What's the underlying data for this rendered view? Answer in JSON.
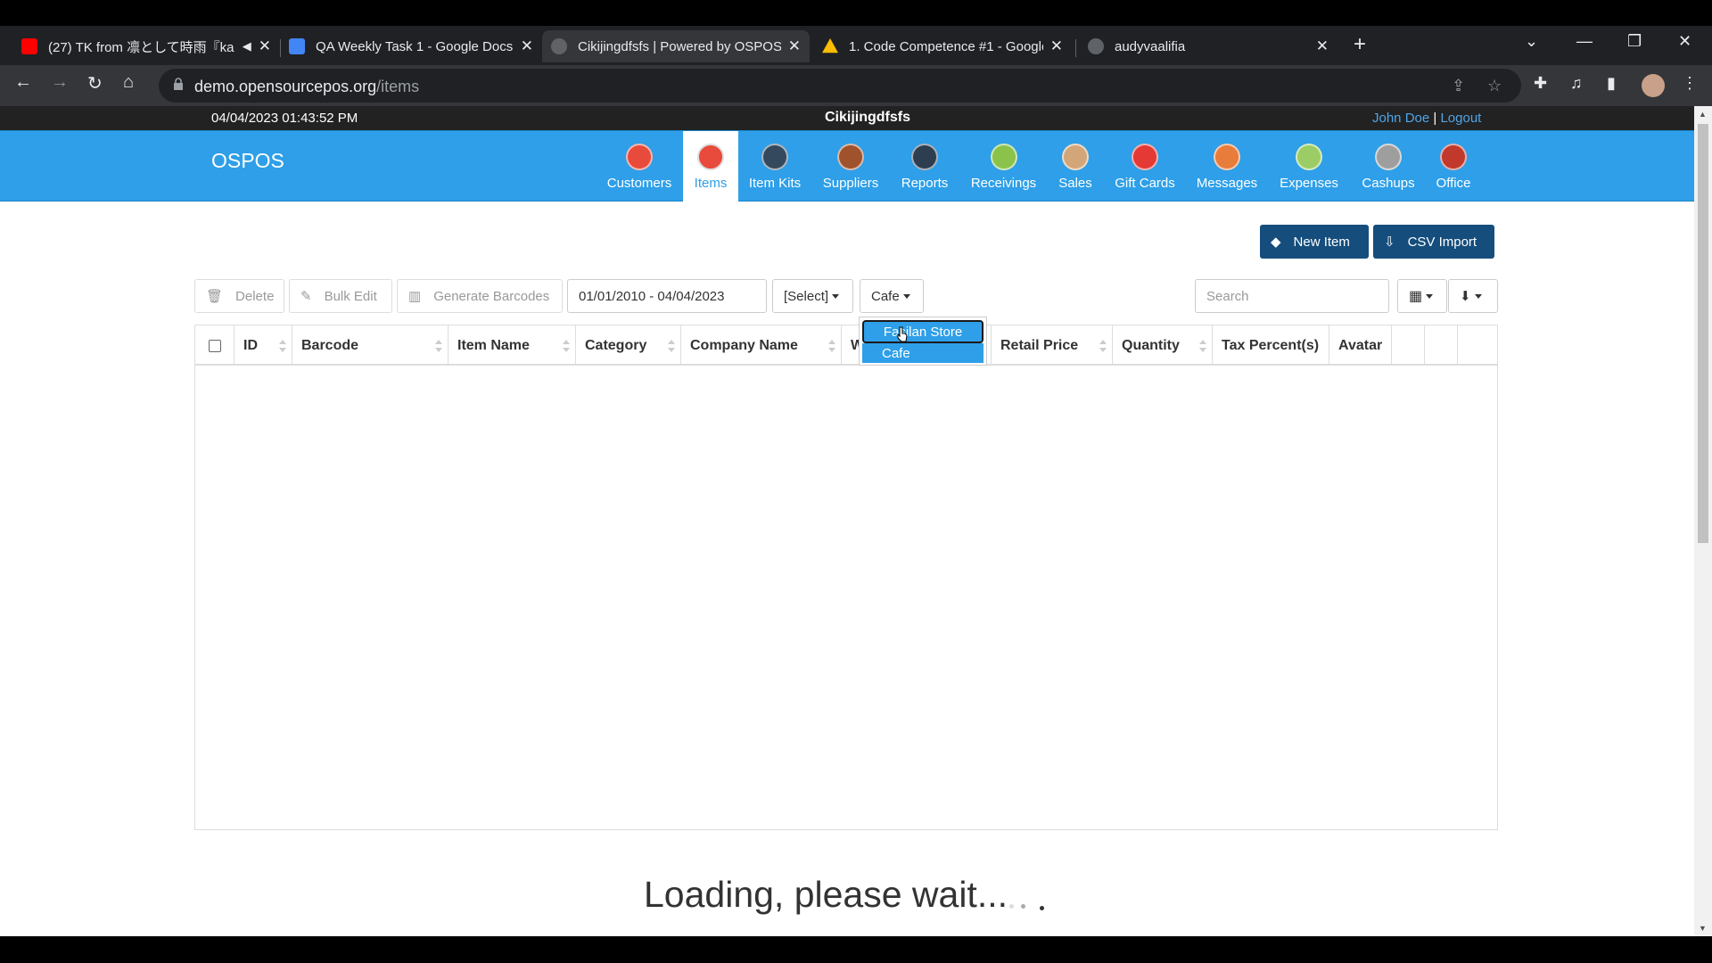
{
  "browser": {
    "tabs": [
      {
        "title": "(27) TK from 凛として時雨『ka",
        "favicon_color": "#ff0000",
        "icon": "youtube-icon"
      },
      {
        "title": "QA Weekly Task 1 - Google Docs",
        "favicon_color": "#4285f4",
        "icon": "docs-icon"
      },
      {
        "title": "Cikijingdfsfs | Powered by OSPOS",
        "favicon_color": "#5f6368",
        "icon": "ospos-icon"
      },
      {
        "title": "1. Code Competence #1 - Google",
        "favicon_color": "#fbbc04",
        "icon": "drive-icon"
      },
      {
        "title": "audyvaalifia",
        "favicon_color": "#5f6368",
        "icon": "github-icon"
      }
    ],
    "url_host": "demo.opensourcepos.org",
    "url_path": "/items"
  },
  "header": {
    "datetime": "04/04/2023 01:43:52 PM",
    "site_name": "Cikijingdfsfs",
    "user": "John Doe",
    "separator": " | ",
    "logout": "Logout"
  },
  "nav": {
    "brand": "OSPOS",
    "items": [
      {
        "label": "Customers",
        "color": "#e84a3b"
      },
      {
        "label": "Items",
        "color": "#e84a3b"
      },
      {
        "label": "Item Kits",
        "color": "#34495e"
      },
      {
        "label": "Suppliers",
        "color": "#a0522d"
      },
      {
        "label": "Reports",
        "color": "#2c3e50"
      },
      {
        "label": "Receivings",
        "color": "#8bc34a"
      },
      {
        "label": "Sales",
        "color": "#d2a679"
      },
      {
        "label": "Gift Cards",
        "color": "#e53935"
      },
      {
        "label": "Messages",
        "color": "#e87c3b"
      },
      {
        "label": "Expenses",
        "color": "#9ccc65"
      },
      {
        "label": "Cashups",
        "color": "#9e9e9e"
      },
      {
        "label": "Office",
        "color": "#c0392b"
      }
    ]
  },
  "actions": {
    "new_item": "New Item",
    "csv_import": "CSV Import"
  },
  "filters": {
    "delete": "Delete",
    "bulk_edit": "Bulk Edit",
    "generate_barcodes": "Generate Barcodes",
    "date_range": "01/01/2010 - 04/04/2023",
    "select": "[Select]",
    "stock_location": "Cafe",
    "search_placeholder": "Search"
  },
  "dropdown": {
    "options": [
      "Fasilan Store",
      "Cafe"
    ],
    "highlighted_index": 0
  },
  "table": {
    "columns": [
      "ID",
      "Barcode",
      "Item Name",
      "Category",
      "Company Name",
      "W",
      "Retail Price",
      "Quantity",
      "Tax Percent(s)",
      "Avatar",
      "",
      ""
    ]
  },
  "loading_text": "Loading, please wait..."
}
